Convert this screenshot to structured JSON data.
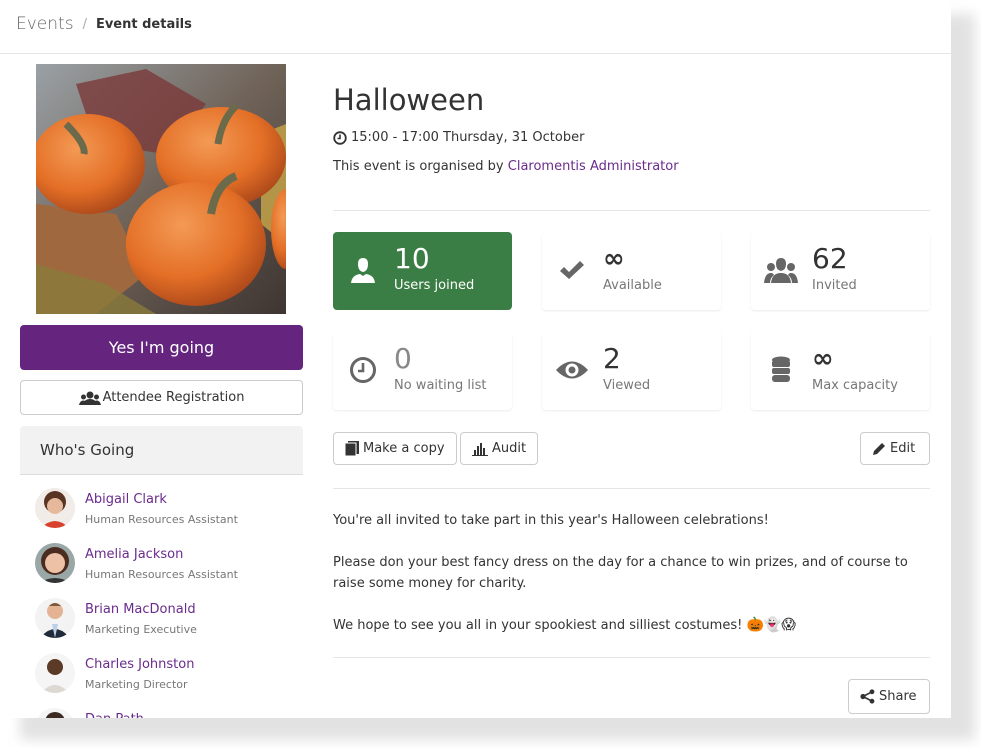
{
  "breadcrumb": {
    "root": "Events",
    "separator": "/",
    "current": "Event details"
  },
  "event": {
    "title": "Halloween",
    "time": "15:00 - 17:00 Thursday, 31 October",
    "organiser_prefix": "This event is organised by",
    "organiser_name": "Claromentis Administrator",
    "image_alt": "Pumpkins on autumn leaves"
  },
  "actions": {
    "going_label": "Yes I'm going",
    "registration_label": "Attendee Registration",
    "make_copy_label": "Make a copy",
    "audit_label": "Audit",
    "edit_label": "Edit",
    "share_label": "Share"
  },
  "stats": [
    {
      "value": "10",
      "label": "Users joined",
      "icon": "user-icon"
    },
    {
      "value": "∞",
      "label": "Available",
      "icon": "check-icon"
    },
    {
      "value": "62",
      "label": "Invited",
      "icon": "group-icon"
    },
    {
      "value": "0",
      "label": "No waiting list",
      "icon": "clock-icon"
    },
    {
      "value": "2",
      "label": "Viewed",
      "icon": "eye-icon"
    },
    {
      "value": "∞",
      "label": "Max capacity",
      "icon": "database-icon"
    }
  ],
  "whos_going": {
    "title": "Who's Going",
    "people": [
      {
        "name": "Abigail Clark",
        "role": "Human Resources Assistant"
      },
      {
        "name": "Amelia Jackson",
        "role": "Human Resources Assistant"
      },
      {
        "name": "Brian MacDonald",
        "role": "Marketing Executive"
      },
      {
        "name": "Charles Johnston",
        "role": "Marketing Director"
      },
      {
        "name": "Dan Path",
        "role": ""
      }
    ]
  },
  "description": {
    "p1": "You're all invited to take part in this year's Halloween celebrations!",
    "p2": "Please don your best fancy dress on the day for a chance to win prizes, and of course to raise some money for charity.",
    "p3": "We hope to see you all in your spookiest and silliest costumes!",
    "emojis": [
      "🎃",
      "👻",
      "😱"
    ]
  },
  "colors": {
    "primary": "#65257f",
    "link": "#6a2b8c",
    "success": "#3b7e45"
  }
}
